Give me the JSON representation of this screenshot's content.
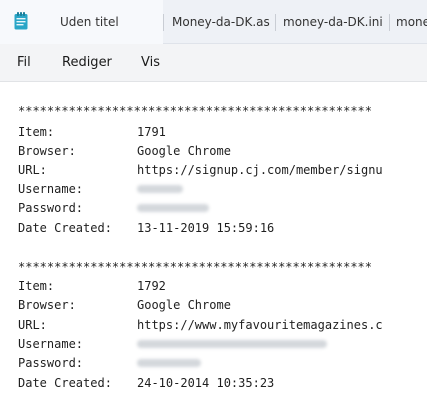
{
  "tabs": [
    {
      "label": "Uden titel",
      "active": true
    },
    {
      "label": "Money-da-DK.as",
      "active": false
    },
    {
      "label": "money-da-DK.ini",
      "active": false
    },
    {
      "label": "mone",
      "active": false
    }
  ],
  "menu": {
    "file": "Fil",
    "edit": "Rediger",
    "view": "Vis"
  },
  "entries": [
    {
      "separator": "*************************************************",
      "item_label": "Item:",
      "item": "1791",
      "browser_label": "Browser:",
      "browser": "Google Chrome",
      "url_label": "URL:",
      "url": "https://signup.cj.com/member/signu",
      "username_label": "Username:",
      "password_label": "Password:",
      "date_label": "Date Created:",
      "date": "13-11-2019 15:59:16"
    },
    {
      "separator": "*************************************************",
      "item_label": "Item:",
      "item": "1792",
      "browser_label": "Browser:",
      "browser": "Google Chrome",
      "url_label": "URL:",
      "url": "https://www.myfavouritemagazines.c",
      "username_label": "Username:",
      "password_label": "Password:",
      "date_label": "Date Created:",
      "date": "24-10-2014 10:35:23"
    }
  ],
  "colors": {
    "tabbar_bg": "#eef1f6",
    "active_tab_bg": "#f7f9fc",
    "menubar_bg": "#f3f4f6",
    "icon_accent": "#2aa6c7"
  }
}
